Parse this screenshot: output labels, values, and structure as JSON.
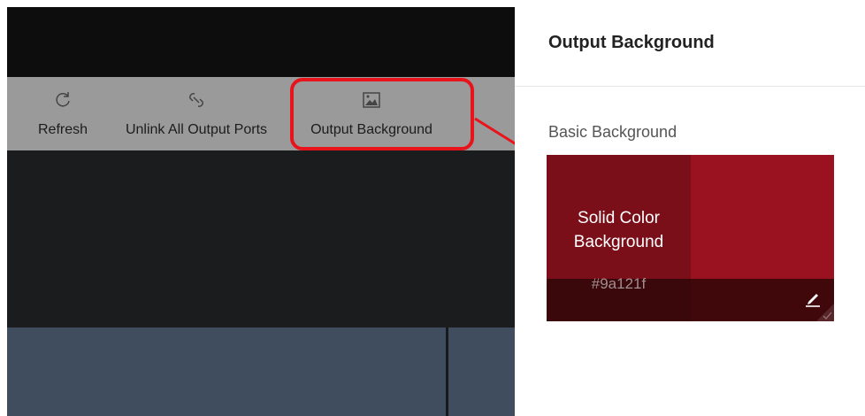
{
  "toolbar": {
    "items": [
      {
        "label": "Refresh",
        "icon": "refresh-icon"
      },
      {
        "label": "Unlink All Output Ports",
        "icon": "unlink-icon"
      },
      {
        "label": "Output Background",
        "icon": "image-icon"
      }
    ]
  },
  "panel": {
    "title": "Output Background",
    "section_label": "Basic Background",
    "card": {
      "title_line1": "Solid Color",
      "title_line2": "Background",
      "hex": "#9a121f",
      "edit_icon": "pencil-icon"
    }
  },
  "annotation": {
    "color": "#e8131b"
  },
  "colors": {
    "topbar": "#0d0d0e",
    "toolbar": "#9a9a9a",
    "workspace": "#1b1c1e",
    "bottom_pane": "#3f4d5e",
    "card_color": "#9a121f"
  }
}
